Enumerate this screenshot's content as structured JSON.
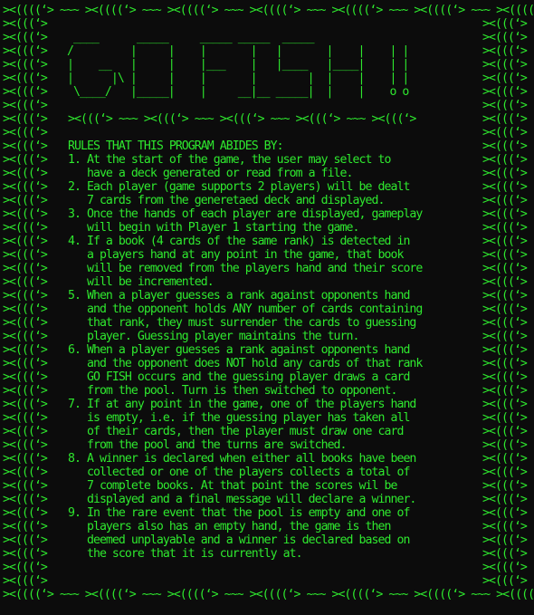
{
  "border": {
    "top": "><((((‘> ~~~ ><((((‘> ~~~ ><((((‘> ~~~ ><((((‘> ~~~ ><((((‘> ~~~ ><((((‘> ~~~ ><((((‘>",
    "bottom": "><((((‘> ~~~ ><((((‘> ~~~ ><((((‘> ~~~ ><((((‘> ~~~ ><((((‘> ~~~ ><((((‘> ~~~ ><((((‘>",
    "side_fish": "><(((‘>",
    "side_rows": 42
  },
  "banner": {
    "art": "   ____      _____     _____ _____  _____\n  /         |     |    |       |   |       |    |    | |\n  |    __   |     |    |___    |   |____   |____|    | |\n  |      |\\ |     |    |       |        |  |    |    | |\n   \\____/   |_____|    |     __|__ _____|  |    |    o o"
  },
  "divider": "><(((‘> ~~~ ><(((‘> ~~~ ><(((‘> ~~~ ><(((‘> ~~~ ><(((‘>",
  "rules": {
    "title": "RULES THAT THIS PROGRAM ABIDES BY:",
    "items": [
      "1. At the start of the game, the user may select to\n   have a deck generated or read from a file.",
      "2. Each player (game supports 2 players) will be dealt\n   7 cards from the generetaed deck and displayed.",
      "3. Once the hands of each player are displayed, gameplay\n   will begin with Player 1 starting the game.",
      "4. If a book (4 cards of the same rank) is detected in\n   a players hand at any point in the game, that book\n   will be removed from the players hand and their score\n   will be incremented.",
      "5. When a player guesses a rank against opponents hand\n   and the opponent holds ANY number of cards containing\n   that rank, they must surrender the cards to guessing\n   player. Guessing player maintains the turn.",
      "6. When a player guesses a rank against opponents hand\n   and the opponent does NOT hold any cards of that rank\n   GO FISH occurs and the guessing player draws a card\n   from the pool. Turn is then switched to opponent.",
      "7. If at any point in the game, one of the players hand\n   is empty, i.e. if the guessing player has taken all\n   of their cards, then the player must draw one card\n   from the pool and the turns are switched.",
      "8. A winner is declared when either all books have been\n   collected or one of the players collects a total of\n   7 complete books. At that point the scores wil be\n   displayed and a final message will declare a winner.",
      "9. In the rare event that the pool is empty and one of\n   players also has an empty hand, the game is then\n   deemed unplayable and a winner is declared based on\n   the score that it is currently at."
    ]
  },
  "colors": {
    "background": "#0c0c0c",
    "text": "#2ee82e"
  }
}
